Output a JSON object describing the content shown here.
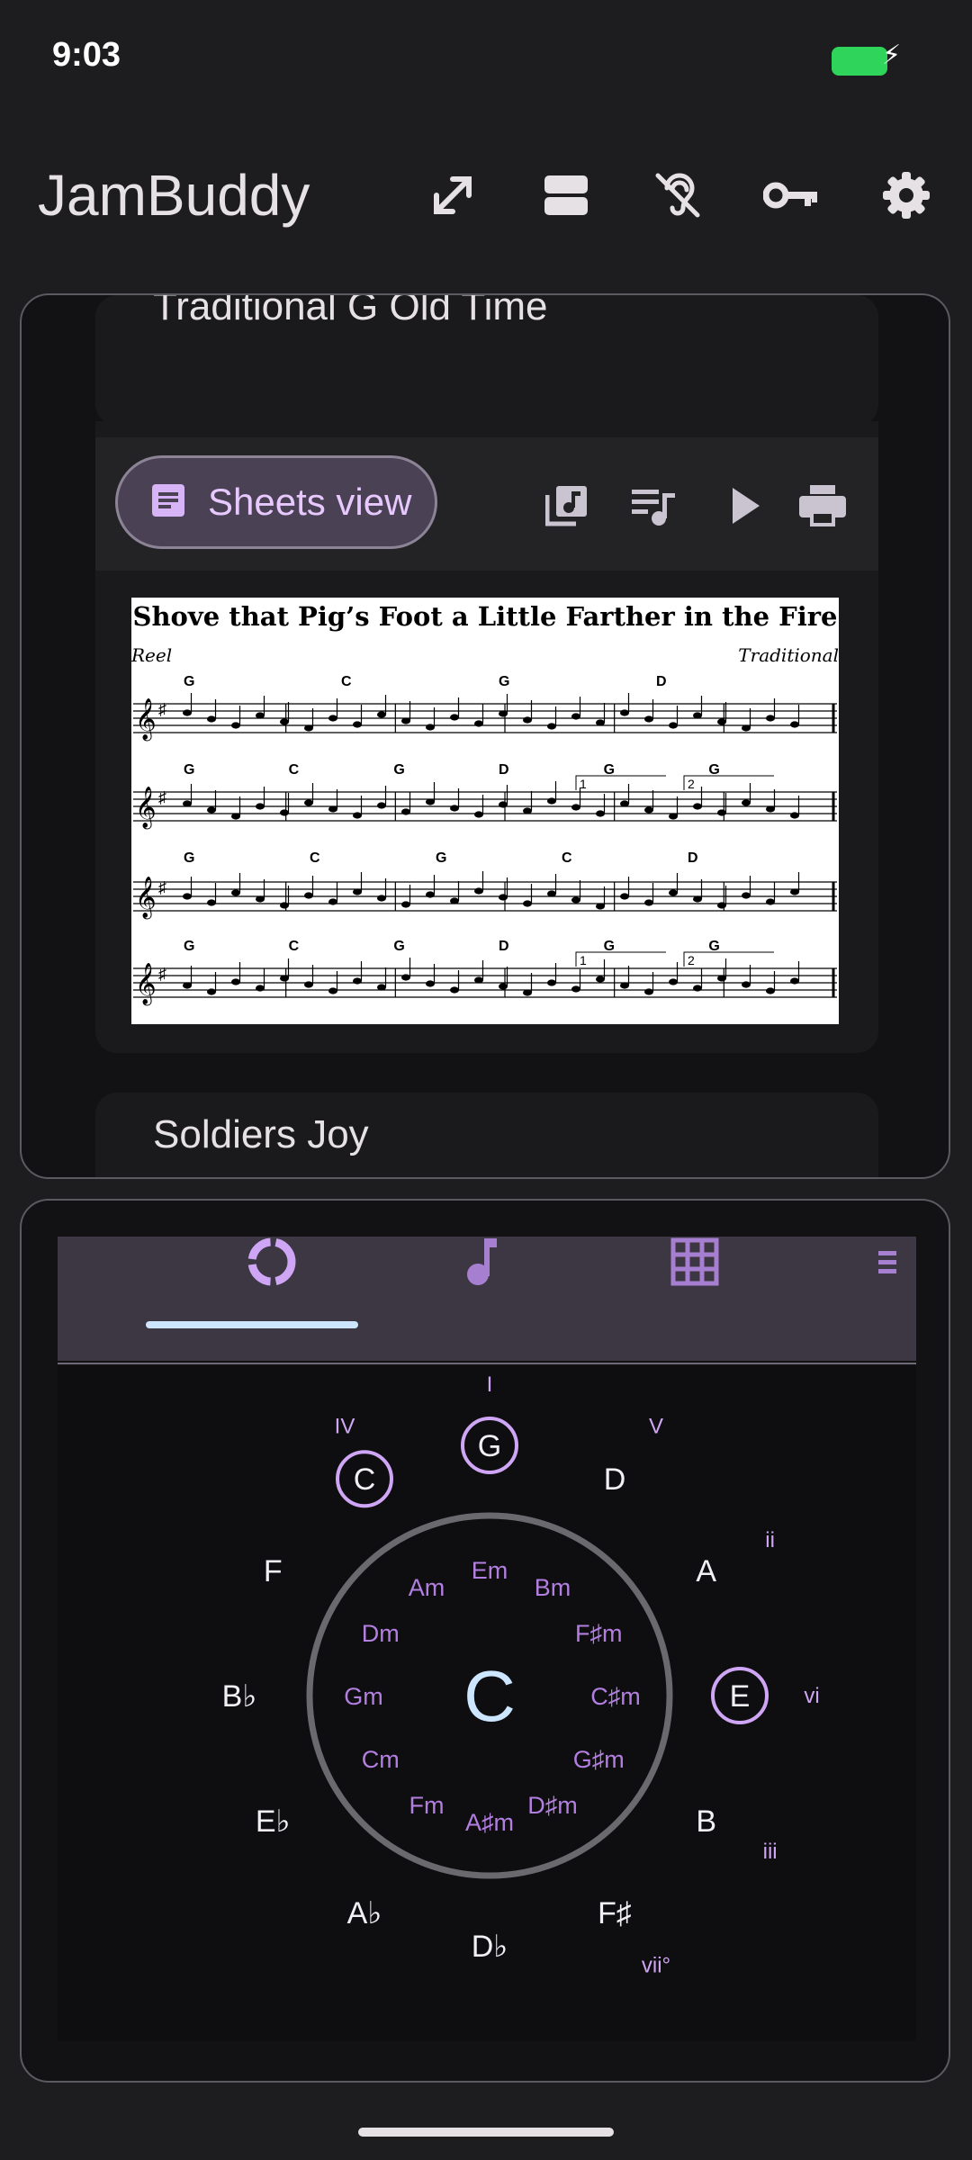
{
  "status": {
    "time": "9:03"
  },
  "header": {
    "title": "JamBuddy",
    "icons": [
      "expand-icon",
      "split-view-icon",
      "hearing-off-icon",
      "key-icon",
      "settings-icon"
    ]
  },
  "tunes": {
    "prev_card_title": "Traditional G Old Time",
    "next_card_title": "Soldiers Joy",
    "sheets_view_label": "Sheets view",
    "toolbar_icons": [
      "library-music-icon",
      "playlist-music-icon",
      "play-icon",
      "print-icon"
    ],
    "sheet": {
      "title": "Shove that Pig’s Foot a Little Farther in the Fire",
      "rhythm": "Reel",
      "composer": "Traditional",
      "lines": [
        {
          "chords": [
            "G",
            "C",
            "G",
            "D"
          ]
        },
        {
          "chords": [
            "G",
            "C",
            "G",
            "D",
            "G",
            "G"
          ],
          "endings": [
            "1",
            "2"
          ]
        },
        {
          "chords": [
            "G",
            "C",
            "G",
            "C",
            "D"
          ]
        },
        {
          "chords": [
            "G",
            "C",
            "G",
            "D",
            "G",
            "G"
          ],
          "endings": [
            "1",
            "2"
          ]
        }
      ]
    }
  },
  "wheel": {
    "tabs": [
      "circle-of-fifths-icon",
      "note-icon",
      "grid-icon",
      "list-icon"
    ],
    "active_tab": 0,
    "center": "C",
    "outer_keys": [
      "G",
      "D",
      "A",
      "E",
      "B",
      "F♯",
      "D♭",
      "A♭",
      "E♭",
      "B♭",
      "F",
      "C"
    ],
    "inner_keys": [
      "Em",
      "Bm",
      "F♯m",
      "C♯m",
      "G♯m",
      "D♯m",
      "A♯m",
      "Fm",
      "Cm",
      "Gm",
      "Dm",
      "Am"
    ],
    "degrees": [
      {
        "key": "G",
        "numeral": "I"
      },
      {
        "key": "D",
        "numeral": "V"
      },
      {
        "key": "A",
        "numeral": "ii"
      },
      {
        "key": "E",
        "numeral": "vi"
      },
      {
        "key": "B",
        "numeral": "iii"
      },
      {
        "key": "F♯",
        "numeral": "vii°"
      },
      {
        "key": "C",
        "numeral": "IV"
      }
    ],
    "highlighted": [
      "G",
      "E",
      "C"
    ],
    "colors": {
      "accent": "#cfa6f5",
      "inner": "#b27fe0",
      "outer": "#f3f0f5"
    }
  }
}
